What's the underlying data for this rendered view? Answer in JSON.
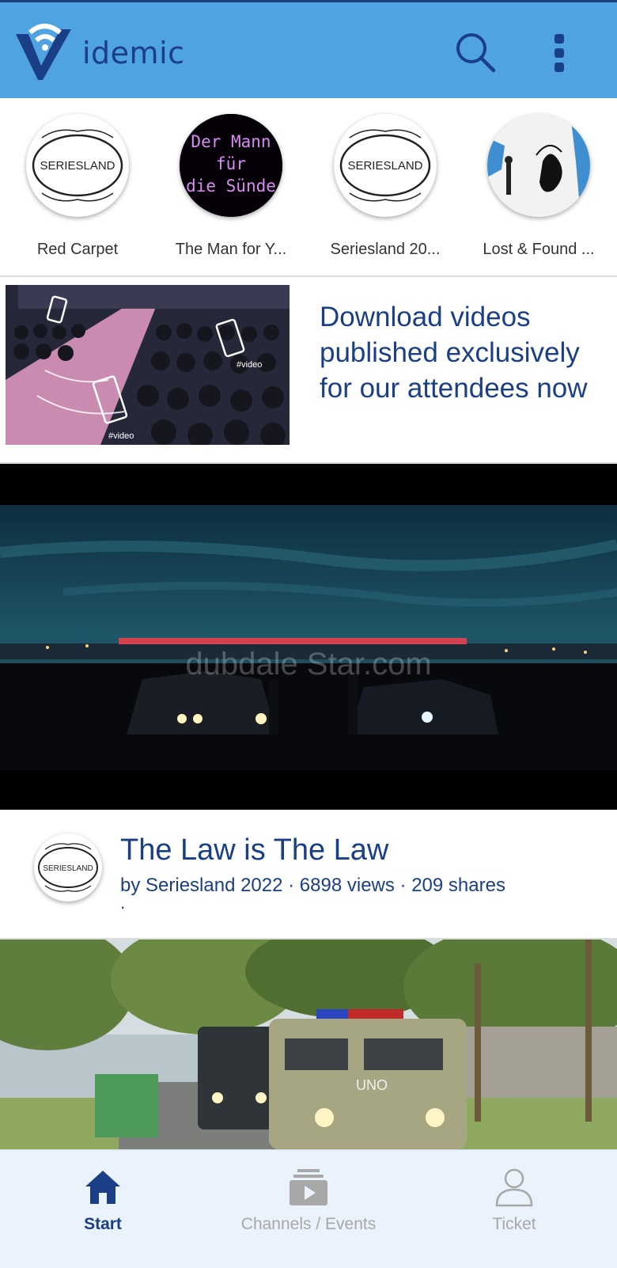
{
  "app": {
    "logo_text": "idemic",
    "colors": {
      "header": "#4ea3e0",
      "brand": "#1b3f86",
      "nav_bg": "#eaf2fb",
      "inactive": "#a8a8a8"
    }
  },
  "header": {
    "search_icon": "search-icon",
    "menu_icon": "more-vertical-icon"
  },
  "channels": [
    {
      "name": "Red Carpet",
      "avatar_text": "SERIESLAND"
    },
    {
      "name": "The Man for Y...",
      "avatar_text": "Der Mann für die Sünde"
    },
    {
      "name": "Seriesland 20...",
      "avatar_text": "SERIESLAND"
    },
    {
      "name": "Lost & Found ..."
    }
  ],
  "promo": {
    "text": "Download videos published exclusively for our attendees now",
    "image_tag": "#video"
  },
  "featured_video": {
    "watermark": "dubdale Star.com",
    "channel_avatar_text": "SERIESLAND",
    "title": "The Law is The Law",
    "meta": "by Seriesland 2022 · 6898 views · 209 shares",
    "meta_dot": "·"
  },
  "second_video": {
    "vehicle_text": "UNO"
  },
  "bottom_nav": [
    {
      "label": "Start",
      "icon": "home-icon",
      "active": true
    },
    {
      "label": "Channels / Events",
      "icon": "channels-play-icon",
      "active": false
    },
    {
      "label": "Ticket",
      "icon": "person-icon",
      "active": false
    }
  ]
}
